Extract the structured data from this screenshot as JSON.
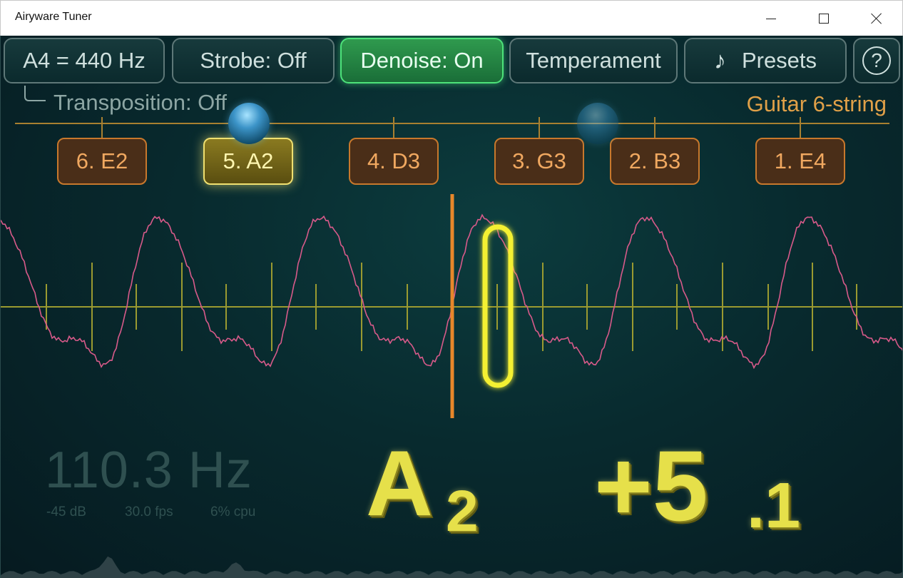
{
  "window": {
    "title": "Airyware Tuner"
  },
  "toolbar": {
    "reference": "A4 = 440 Hz",
    "strobe": "Strobe: Off",
    "denoise": "Denoise: On",
    "temperament": "Temperament",
    "presets": "Presets",
    "presets_glyph": "♪",
    "help": "?"
  },
  "transposition": "Transposition: Off",
  "preset_name": "Guitar 6-string",
  "strings": [
    {
      "label": "6. E2",
      "selected": false
    },
    {
      "label": "5. A2",
      "selected": true
    },
    {
      "label": "4. D3",
      "selected": false
    },
    {
      "label": "3. G3",
      "selected": false
    },
    {
      "label": "2. B3",
      "selected": false
    },
    {
      "label": "1. E4",
      "selected": false
    }
  ],
  "readout": {
    "frequency": "110.3 Hz",
    "level": "-45 dB",
    "fps": "30.0 fps",
    "cpu": "6% cpu"
  },
  "note": {
    "letter": "A",
    "octave": "2"
  },
  "cents": {
    "main": "+5",
    "fraction": ".1"
  },
  "colors": {
    "accent_yellow": "#e6e04a",
    "string_orange": "#f0a860",
    "waveform_pink": "#d85a8a",
    "denoise_green": "#2f9a4e"
  }
}
